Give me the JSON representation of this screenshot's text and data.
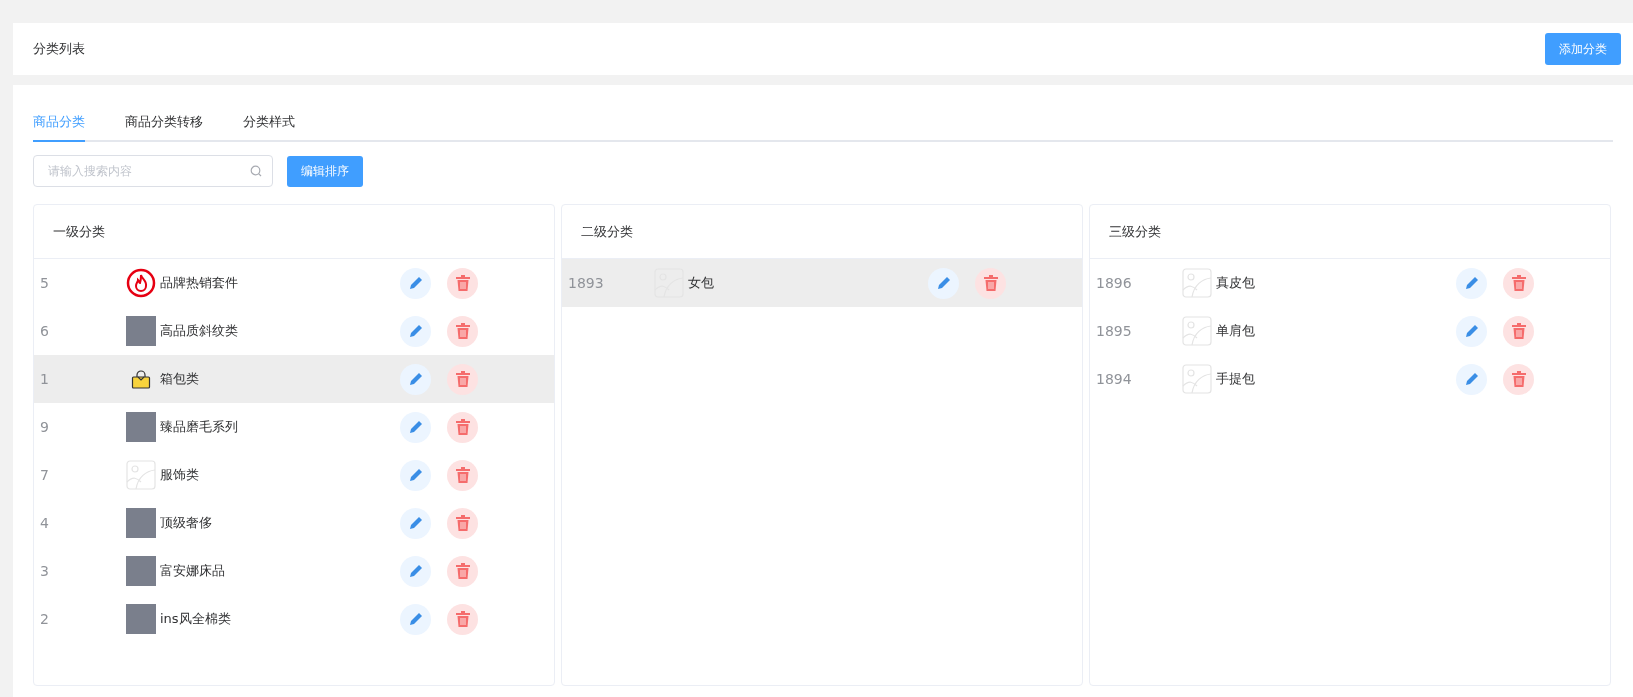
{
  "header": {
    "title": "分类列表",
    "add_button": "添加分类"
  },
  "tabs": [
    {
      "label": "商品分类",
      "selected": true
    },
    {
      "label": "商品分类转移",
      "selected": false
    },
    {
      "label": "分类样式",
      "selected": false
    }
  ],
  "search": {
    "placeholder": "请输入搜索内容"
  },
  "sort_button": "编辑排序",
  "columns": [
    {
      "title": "一级分类",
      "rows": [
        {
          "id": "5",
          "name": "品牌热销套件",
          "kind": "fire",
          "selected": false
        },
        {
          "id": "6",
          "name": "高品质斜纹类",
          "kind": "photo",
          "selected": false
        },
        {
          "id": "1",
          "name": "箱包类",
          "kind": "bag",
          "selected": true
        },
        {
          "id": "9",
          "name": "臻品磨毛系列",
          "kind": "photo",
          "selected": false
        },
        {
          "id": "7",
          "name": "服饰类",
          "kind": "placeholder",
          "selected": false
        },
        {
          "id": "4",
          "name": "顶级奢侈",
          "kind": "photo",
          "selected": false
        },
        {
          "id": "3",
          "name": "富安娜床品",
          "kind": "photo",
          "selected": false
        },
        {
          "id": "2",
          "name": "ins风全棉类",
          "kind": "photo",
          "selected": false
        }
      ]
    },
    {
      "title": "二级分类",
      "rows": [
        {
          "id": "1893",
          "name": "女包",
          "kind": "placeholder",
          "selected": true
        }
      ]
    },
    {
      "title": "三级分类",
      "rows": [
        {
          "id": "1896",
          "name": "真皮包",
          "kind": "placeholder",
          "selected": false
        },
        {
          "id": "1895",
          "name": "单肩包",
          "kind": "placeholder",
          "selected": false
        },
        {
          "id": "1894",
          "name": "手提包",
          "kind": "placeholder",
          "selected": false
        }
      ]
    }
  ]
}
